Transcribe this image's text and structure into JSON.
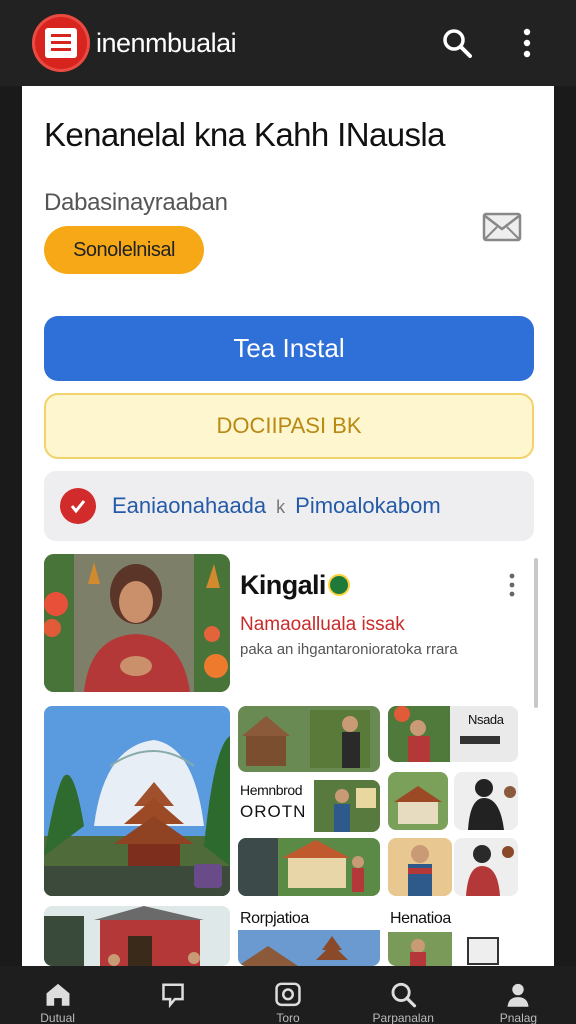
{
  "app": {
    "title": "inenmbualai"
  },
  "header": {
    "search_icon": "search-icon",
    "menu_icon": "more-vert-icon"
  },
  "content": {
    "headline": "Kenanelal kna Kahh INausla",
    "subtitle": "Dabasinayraaban",
    "chip_label": "Sonolelnisal",
    "primary_button": "Tea Instal",
    "secondary_button": "DOCIIPASI BK",
    "verify": {
      "left": "Eaniaonahaada",
      "separator": "k",
      "right": "Pimoalokabom"
    }
  },
  "featured": {
    "title": "Kingali",
    "subtitle": "Namaoalluala issak",
    "description": "paka an ihgantaronioratoka rrara"
  },
  "tiles": {
    "t1": "Nsada",
    "t2": "Hemnbrod",
    "t2b": "OROTN",
    "t3": "Rorpjatioa",
    "t4": "Henatioa"
  },
  "bottom_nav": [
    {
      "label": "Dutual",
      "icon": "home-icon"
    },
    {
      "label": "",
      "icon": "chat-icon"
    },
    {
      "label": "Toro",
      "icon": "camera-icon"
    },
    {
      "label": "Parpanalan",
      "icon": "search-icon"
    },
    {
      "label": "Pnalag",
      "icon": "profile-icon"
    }
  ],
  "colors": {
    "brand": "#d8241f",
    "primary": "#2f6fd8",
    "accent": "#f6a816"
  }
}
